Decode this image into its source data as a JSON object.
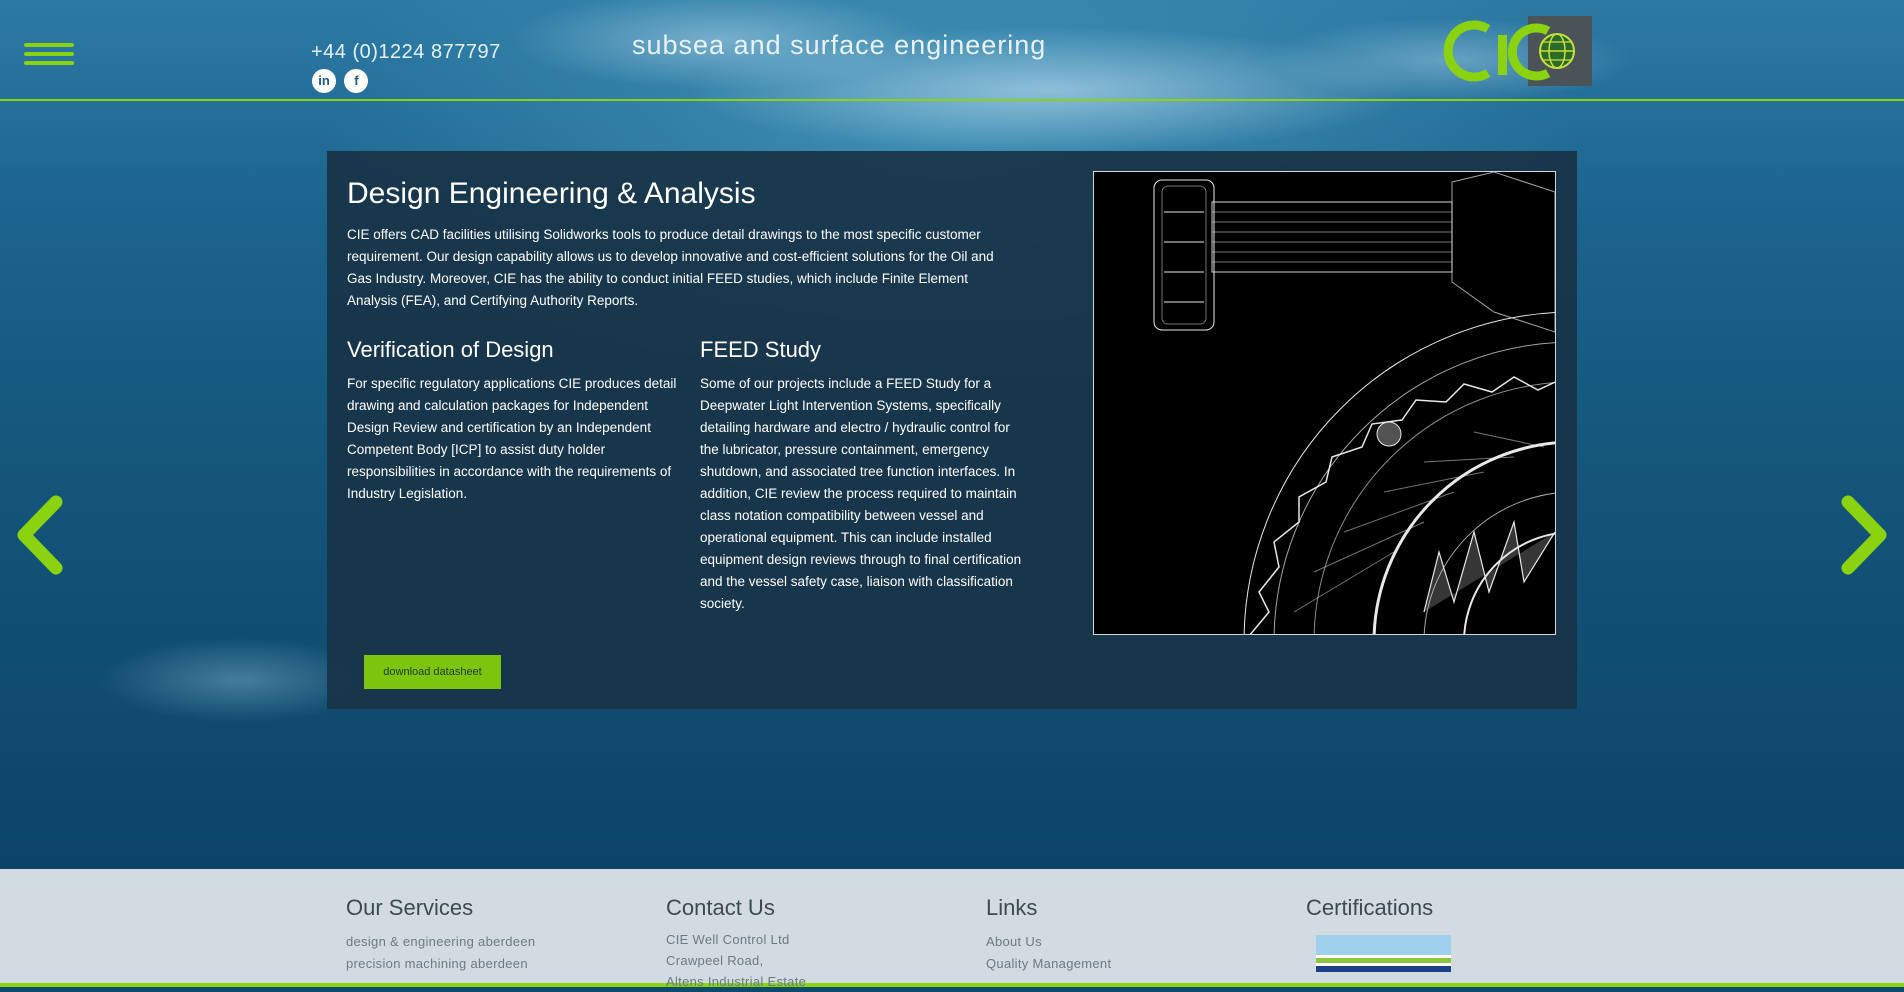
{
  "header": {
    "phone": "+44 (0)1224 877797",
    "tagline": "subsea and surface engineering",
    "logo_text": "CIE",
    "socials": [
      {
        "label": "in",
        "icon": "linkedin-icon"
      },
      {
        "label": "f",
        "icon": "facebook-icon"
      }
    ]
  },
  "panel": {
    "title": "Design Engineering & Analysis",
    "intro": "CIE offers CAD facilities utilising Solidworks tools to produce detail drawings to the most specific customer requirement. Our design capability allows us to develop innovative and cost-efficient solutions for the Oil and Gas Industry. Moreover, CIE has the ability to conduct initial FEED studies, which include Finite Element Analysis (FEA), and Certifying Authority Reports.",
    "col1_title": "Verification of Design",
    "col1_text": "For specific regulatory applications CIE produces detail drawing and calculation packages for Independent Design Review and certification by an Independent Competent Body [ICP] to assist duty holder responsibilities in accordance with the requirements of Industry Legislation.",
    "col2_title": "FEED Study",
    "col2_text": "Some of our projects include a FEED Study for a Deepwater Light Intervention Systems, specifically detailing hardware and electro / hydraulic control for the lubricator, pressure containment, emergency shutdown, and associated tree function interfaces. In addition, CIE review the process required to maintain class notation compatibility between vessel and operational equipment. This can include installed equipment design reviews through to final certification and the vessel safety case, liaison with classification society.",
    "download_label": "download datasheet"
  },
  "footer": {
    "services_title": "Our Services",
    "services": [
      "design & engineering aberdeen",
      "precision machining aberdeen"
    ],
    "contact_title": "Contact Us",
    "contact": [
      "CIE Well Control Ltd",
      "Crawpeel Road,",
      "Altens Industrial Estate"
    ],
    "links_title": "Links",
    "links": [
      "About Us",
      "Quality Management"
    ],
    "certs_title": "Certifications"
  },
  "colors": {
    "accent": "#8bd210",
    "panel_bg": "#183448",
    "footer_bg": "#d3dbe2"
  }
}
